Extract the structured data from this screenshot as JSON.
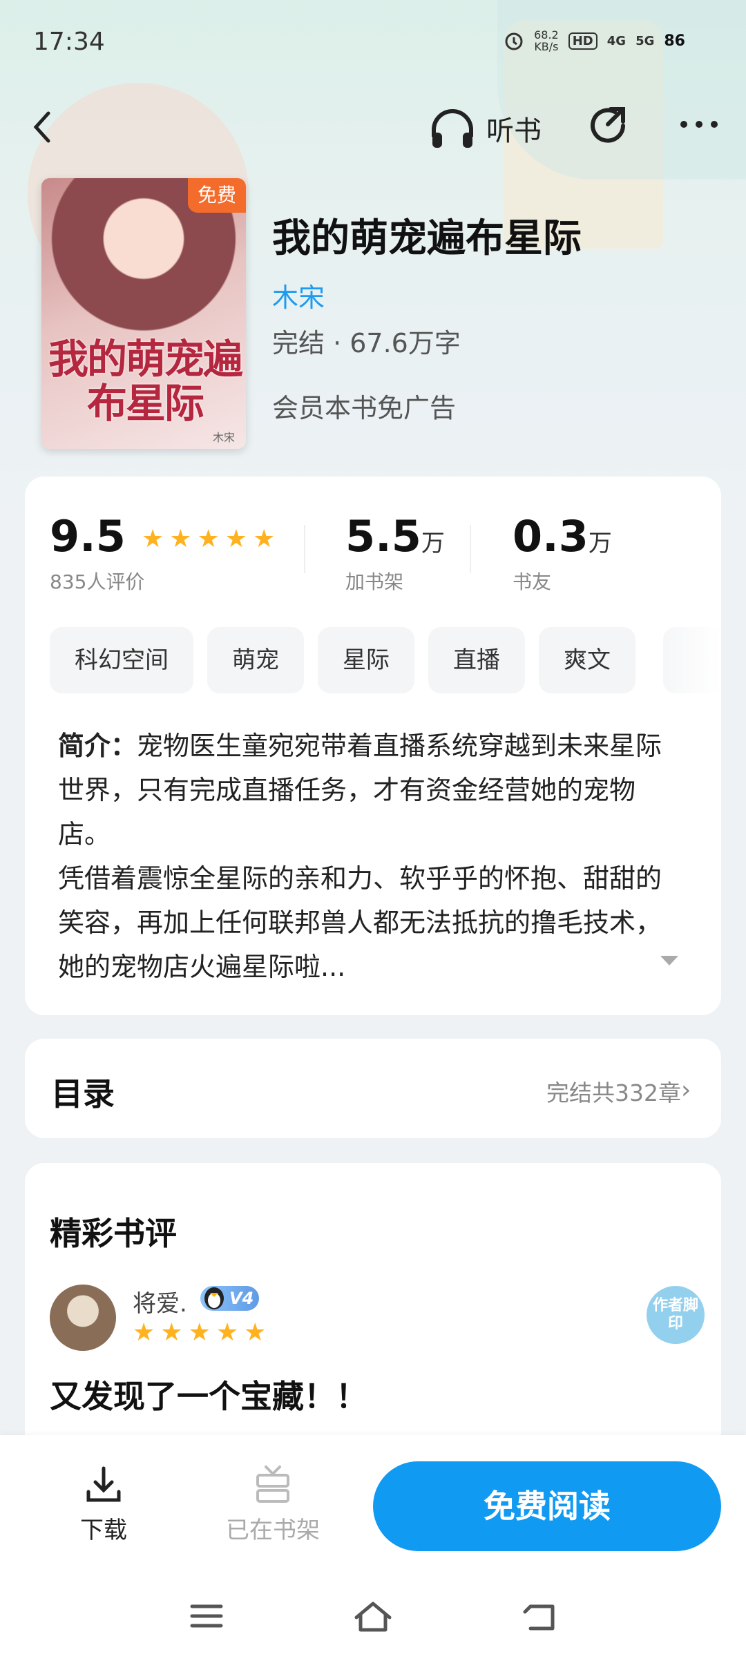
{
  "status_bar": {
    "time": "17:34",
    "speed_value": "68.2",
    "speed_unit": "KB/s",
    "hd_label": "HD",
    "net1": "4G",
    "net2": "5G",
    "battery": "86"
  },
  "header": {
    "listen_label": "听书"
  },
  "book": {
    "cover_title": "我的萌宠遍布星际",
    "cover_author": "木宋",
    "free_tag": "免费",
    "title": "我的萌宠遍布星际",
    "author": "木宋",
    "meta": "完结 · 67.6万字",
    "vip_note": "会员本书免广告"
  },
  "stats": {
    "rating": "9.5",
    "rating_count": "835人评价",
    "shelf_value": "5.5",
    "shelf_unit": "万",
    "shelf_label": "加书架",
    "fans_value": "0.3",
    "fans_unit": "万",
    "fans_label": "书友",
    "stars": 5
  },
  "tags": [
    "科幻空间",
    "萌宠",
    "星际",
    "直播",
    "爽文"
  ],
  "intro": {
    "label": "简介：",
    "text": "宠物医生童宛宛带着直播系统穿越到未来星际世界，只有完成直播任务，才有资金经营她的宠物店。",
    "text2": "凭借着震惊全星际的亲和力、软乎乎的怀抱、甜甜的笑容，再加上任何联邦兽人都无法抵抗的撸毛技术，她的宠物店火遍星际啦..."
  },
  "toc": {
    "title": "目录",
    "count": "完结共332章"
  },
  "reviews": {
    "title": "精彩书评",
    "user": "将爱.",
    "level": "V4",
    "stamp_text": "作者脚印",
    "stars": 5,
    "text": "又发现了一个宝藏！！"
  },
  "bottom": {
    "download_label": "下载",
    "shelf_label": "已在书架",
    "read_label": "免费阅读"
  },
  "colors": {
    "accent": "#119af2",
    "author_link": "#1e9bf0",
    "star": "#ffb21f",
    "free_tag": "#f36c2c"
  }
}
